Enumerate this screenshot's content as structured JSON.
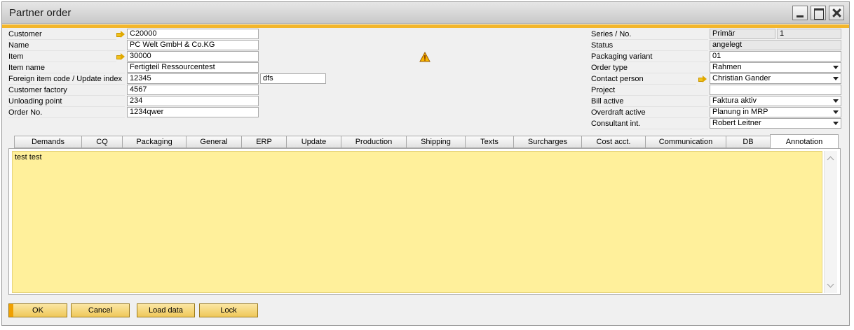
{
  "window": {
    "title": "Partner order"
  },
  "left_fields": [
    {
      "label": "Customer",
      "value": "C20000",
      "link": true
    },
    {
      "label": "Name",
      "value": "PC Welt GmbH & Co.KG",
      "link": false
    },
    {
      "label": "Item",
      "value": "30000",
      "link": true
    },
    {
      "label": "Item name",
      "value": "Fertigteil Ressourcentest",
      "link": false
    },
    {
      "label": "Foreign item code / Update index",
      "value": "12345",
      "value2": "dfs",
      "link": false
    },
    {
      "label": "Customer factory",
      "value": "4567",
      "link": false
    },
    {
      "label": "Unloading point",
      "value": "234",
      "link": false
    },
    {
      "label": "Order No.",
      "value": "1234qwer",
      "link": false
    }
  ],
  "right_fields": [
    {
      "label": "Series / No.",
      "value": "Primär",
      "value2": "1",
      "type": "readonly"
    },
    {
      "label": "Status",
      "value": "angelegt",
      "type": "readonly"
    },
    {
      "label": "Packaging variant",
      "value": "01",
      "type": "text"
    },
    {
      "label": "Order type",
      "value": "Rahmen",
      "type": "dropdown"
    },
    {
      "label": "Contact person",
      "value": "Christian Gander",
      "type": "dropdown",
      "link": true
    },
    {
      "label": "Project",
      "value": "",
      "type": "text"
    },
    {
      "label": "Bill active",
      "value": "Faktura aktiv",
      "type": "dropdown"
    },
    {
      "label": "Overdraft active",
      "value": "Planung in MRP",
      "type": "dropdown"
    },
    {
      "label": "Consultant int.",
      "value": "Robert Leitner",
      "type": "dropdown"
    }
  ],
  "tabs": [
    "Demands",
    "CQ",
    "Packaging",
    "General",
    "ERP",
    "Update",
    "Production",
    "Shipping",
    "Texts",
    "Surcharges",
    "Cost acct.",
    "Communication",
    "DB",
    "Annotation"
  ],
  "active_tab": "Annotation",
  "annotation": {
    "text": "test test"
  },
  "buttons": {
    "ok": "OK",
    "cancel": "Cancel",
    "load": "Load data",
    "lock": "Lock"
  },
  "colors": {
    "accent": "#f3b62b",
    "note_bg": "#fff09b",
    "button": "#efc85a"
  }
}
